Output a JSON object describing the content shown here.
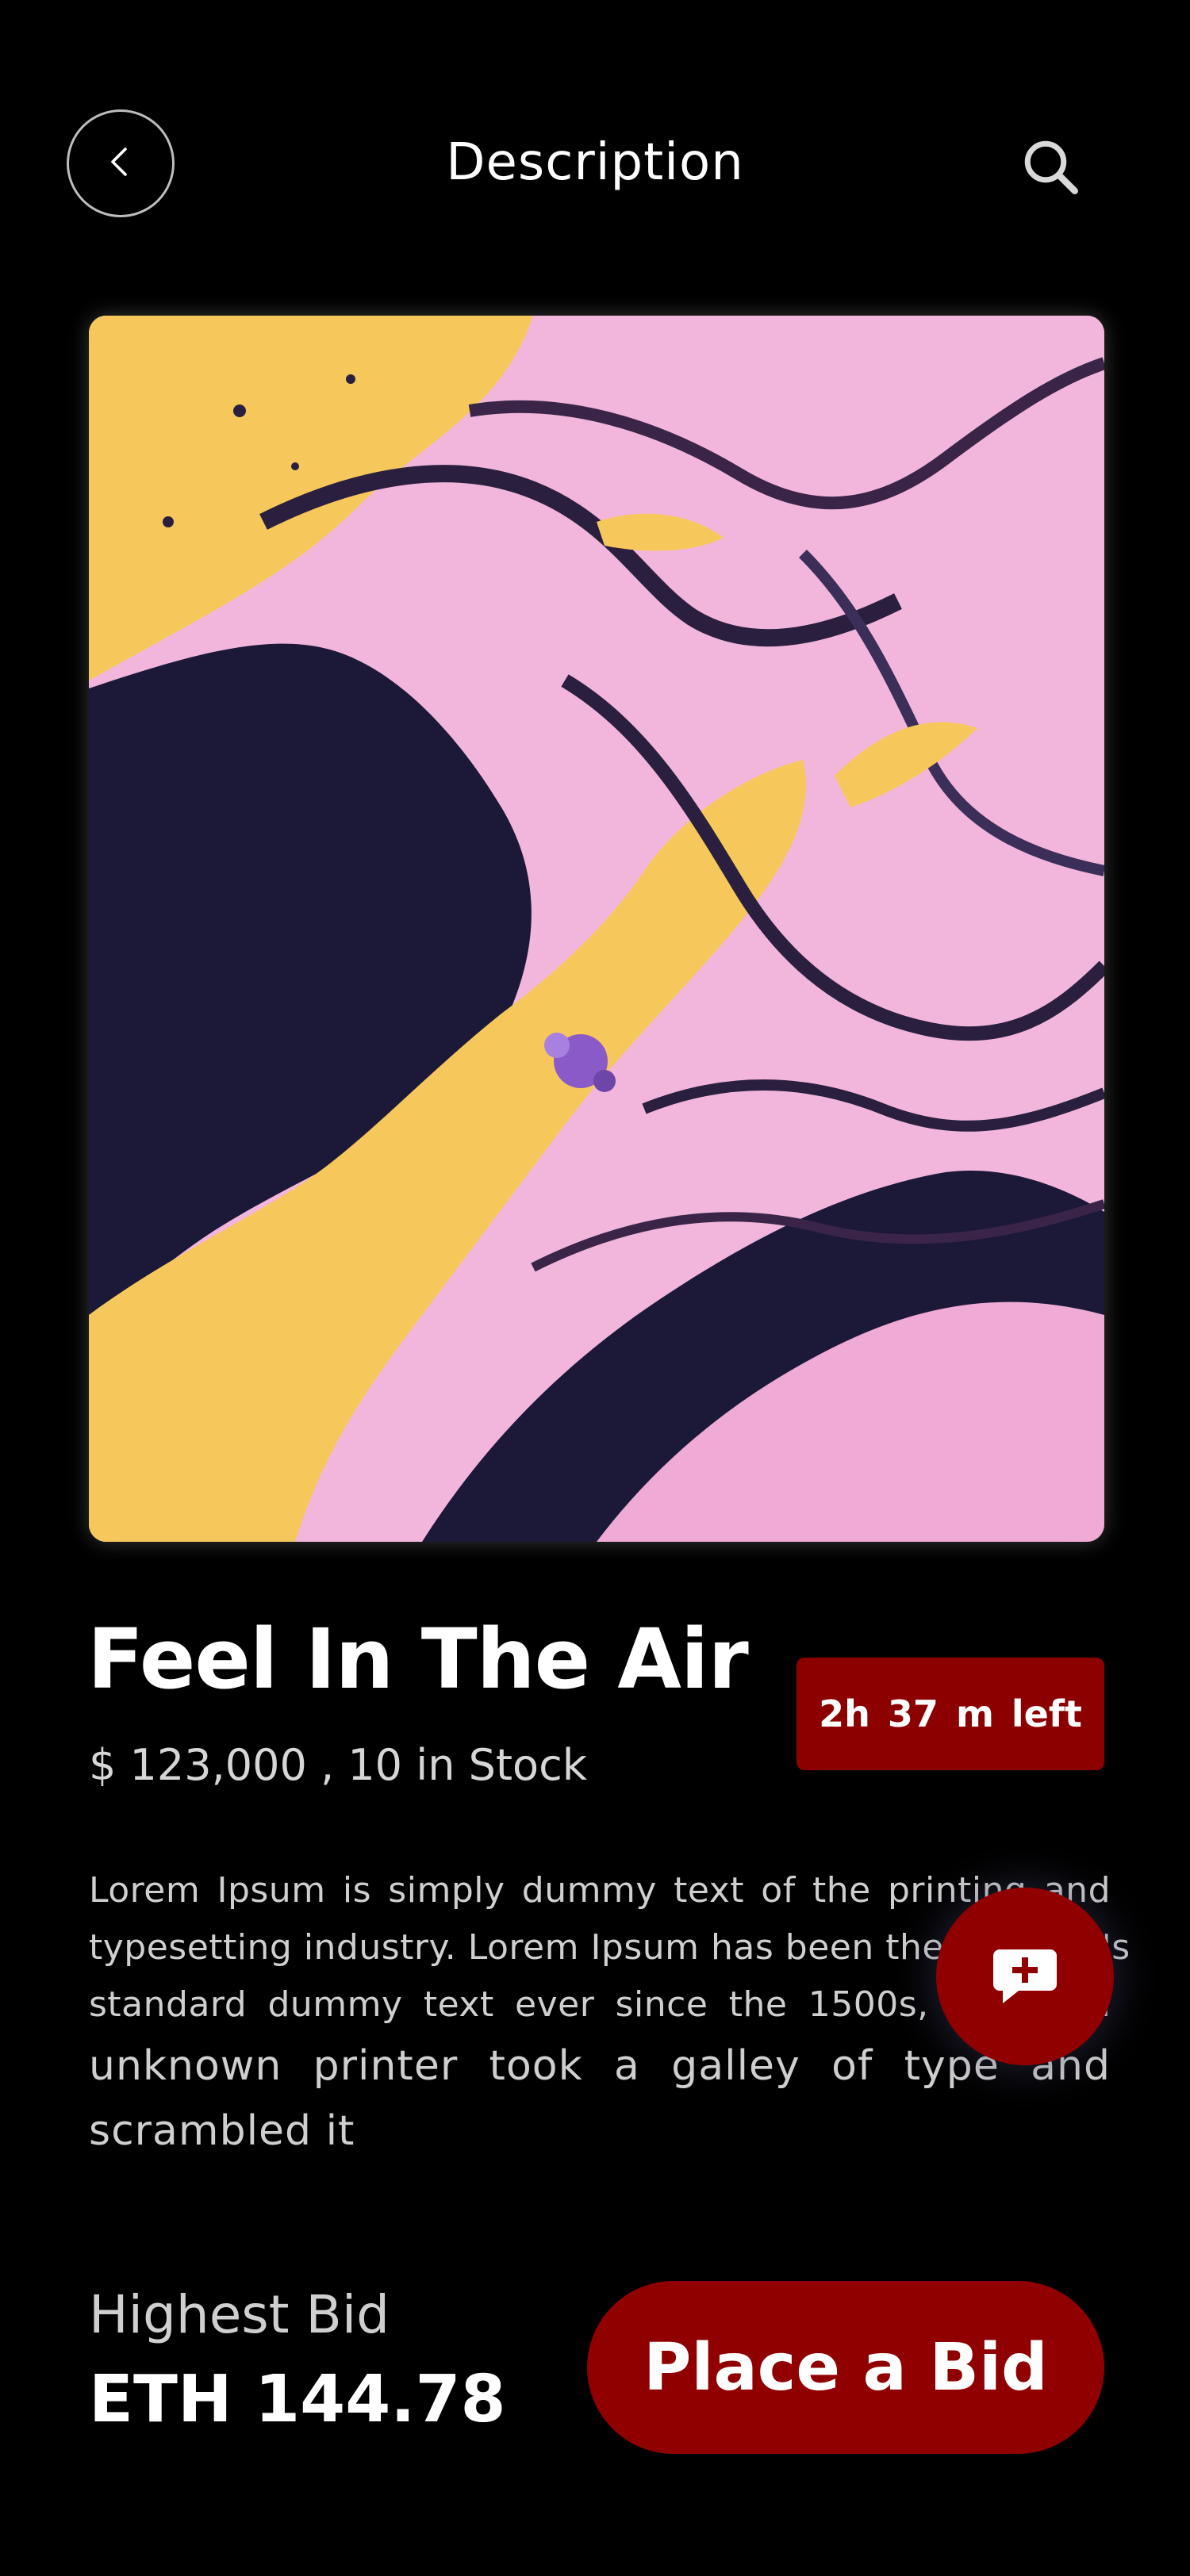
{
  "header": {
    "title": "Description",
    "back_icon": "chevron-left-icon",
    "search_icon": "search-icon"
  },
  "artwork": {
    "description_icon": "abstract-fluid-art-image",
    "colors": {
      "pink": "#f2b6dd",
      "yellow": "#f6c85c",
      "navy": "#1b1838",
      "purple": "#8a5bc8"
    }
  },
  "item": {
    "title": "Feel In The Air",
    "price_stock": "$ 123,000 , 10 in Stock",
    "time_left": "2h  37 m  left"
  },
  "description": {
    "lines": [
      "Lorem Ipsum is simply dummy text of the printing and",
      "typesetting industry. Lorem Ipsum has been the industry's",
      "standard dummy text ever since the 1500s, when an",
      "unknown printer took a galley of type and",
      "scrambled it"
    ]
  },
  "fab": {
    "icon": "chat-add-icon"
  },
  "bid": {
    "label": "Highest Bid",
    "value": "ETH 144.78",
    "button_label": "Place a Bid"
  },
  "colors": {
    "background": "#000000",
    "accent": "#900000",
    "text": "#ffffff",
    "muted": "#cfcfcf"
  }
}
